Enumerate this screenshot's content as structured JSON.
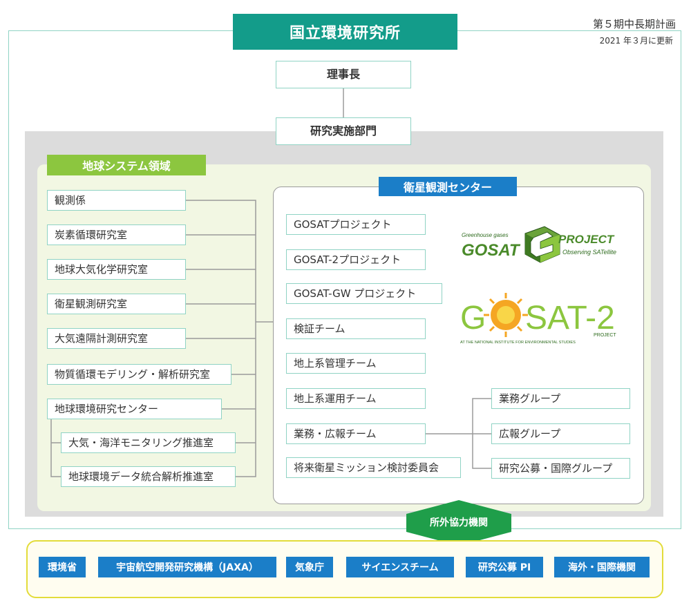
{
  "header": {
    "org_title": "国立環境研究所",
    "plan_name": "第５期中長期計画",
    "plan_updated": "2021 年３月に更新"
  },
  "top_nodes": {
    "president": "理事長",
    "research_division": "研究実施部門"
  },
  "earth_system": {
    "label": "地球システム領域",
    "items": [
      "観測係",
      "炭素循環研究室",
      "地球大気化学研究室",
      "衛星観測研究室",
      "大気遠隔計測研究室",
      "物質循環モデリング・解析研究室",
      "地球環境研究センター"
    ],
    "sub_items": [
      "大気・海洋モニタリング推進室",
      "地球環境データ統合解析推進室"
    ]
  },
  "satellite_center": {
    "label": "衛星観測センター",
    "items": [
      "GOSATプロジェクト",
      "GOSAT-2プロジェクト",
      "GOSAT-GW プロジェクト",
      "検証チーム",
      "地上系管理チーム",
      "地上系運用チーム",
      "業務・広報チーム",
      "将来衛星ミッション検討委員会"
    ],
    "groups": [
      "業務グループ",
      "広報グループ",
      "研究公募・国際グループ"
    ]
  },
  "logos": {
    "gosat": {
      "top_text": "Greenhouse gases",
      "word_left": "GOSAT",
      "word_right": "PROJECT",
      "bottom_text": "Observing SATellite"
    },
    "gosat2": {
      "word_g": "G",
      "word_sat": "SAT-2",
      "project": "PROJECT",
      "institute": "AT THE NATIONAL INSTITUTE FOR ENVIRONMENTAL STUDIES"
    }
  },
  "cooperation": {
    "label": "所外協力機関",
    "partners": [
      "環境省",
      "宇宙航空開発研究機構（JAXA）",
      "気象庁",
      "サイエンスチーム",
      "研究公募 PI",
      "海外・国際機関"
    ]
  },
  "colors": {
    "teal": "#139c8a",
    "green": "#8cc63f",
    "blue": "#1b7ec8",
    "box_border": "#8fd3c4",
    "yellow": "#e3dc3a"
  }
}
